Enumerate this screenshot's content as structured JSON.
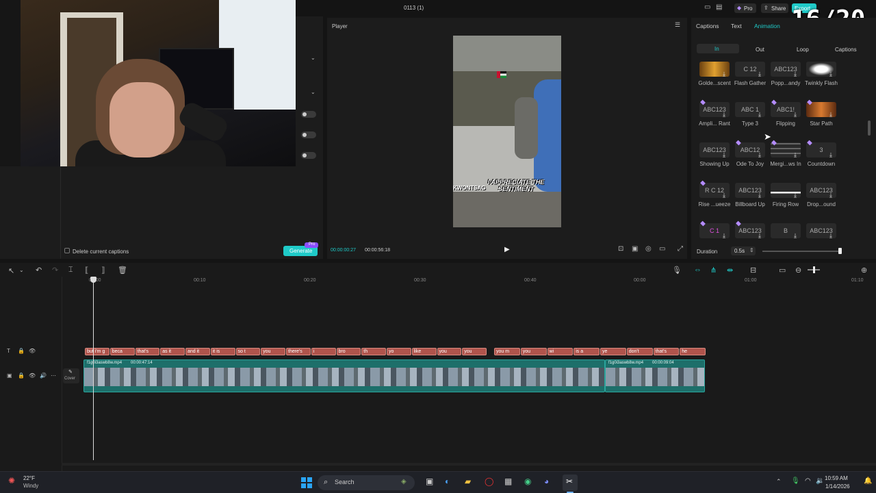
{
  "overlay": {
    "counter": "16/20"
  },
  "titlebar": {
    "title": "0113 (1)",
    "pro_label": "Pro",
    "share_label": "Share",
    "export_label": "Export"
  },
  "left": {
    "delete_captions_label": "Delete current captions",
    "generate_label": "Generate",
    "pro_badge": "Pro"
  },
  "player": {
    "title": "Player",
    "caption_text": "I APPRECIATE THE SENTIMENT",
    "side_text": "KWONTSAG",
    "current_time": "00:00:00:27",
    "total_time": "00:00:56:18"
  },
  "right": {
    "tabs": [
      "Captions",
      "Text",
      "Animation"
    ],
    "active_tab": "Animation",
    "subtabs": [
      "In",
      "Out",
      "Loop",
      "Captions"
    ],
    "active_subtab": "In",
    "presets": [
      {
        "label": "Golde...scent",
        "preview": ""
      },
      {
        "label": "Flash Gather",
        "preview": "C 12"
      },
      {
        "label": "Popp...andy",
        "preview": "ABC123"
      },
      {
        "label": "Twinkly Flash",
        "preview": ""
      },
      {
        "label": "Ampli... Rant",
        "preview": "ABC123"
      },
      {
        "label": "Type 3",
        "preview": "ABC 1"
      },
      {
        "label": "Flipping",
        "preview": "ABC1!"
      },
      {
        "label": "Star Path",
        "preview": ""
      },
      {
        "label": "Showing Up",
        "preview": "ABC123"
      },
      {
        "label": "Ode To Joy",
        "preview": "ABC12"
      },
      {
        "label": "Mergi...ws In",
        "preview": ""
      },
      {
        "label": "Countdown",
        "preview": "3"
      },
      {
        "label": "Rise ...ueeze",
        "preview": "R C 12"
      },
      {
        "label": "Billboard Up",
        "preview": "ABC123"
      },
      {
        "label": "Firing Row",
        "preview": ""
      },
      {
        "label": "Drop...ound",
        "preview": "ABC123"
      },
      {
        "label": "",
        "preview": "C 1"
      },
      {
        "label": "",
        "preview": "ABC123"
      },
      {
        "label": "",
        "preview": "B"
      },
      {
        "label": "",
        "preview": "ABC123"
      }
    ],
    "duration_label": "Duration",
    "duration_value": "0.5s"
  },
  "timeline": {
    "ticks": [
      "00:00",
      "00:10",
      "00:20",
      "00:30",
      "00:40",
      "00:00",
      "01:00",
      "01:10"
    ],
    "caption_clips": [
      "but i'm g",
      "beca",
      "that's",
      "as it",
      "and it",
      "it is",
      "so t",
      "you",
      "there's",
      "i",
      "bro",
      "th",
      "yo",
      "like",
      "you",
      "you",
      "you m",
      "you",
      "wi",
      "is a",
      "ye",
      "don't",
      "that's",
      "he"
    ],
    "video_clip_1": {
      "name": "f1g0i3aswb8w.mp4",
      "duration": "00:00:47:14"
    },
    "video_clip_2": {
      "name": "f1g0i3aswb8w.mp4",
      "duration": "00:00:09:04"
    },
    "cover_label": "Cover"
  },
  "taskbar": {
    "weather_temp": "22°F",
    "weather_desc": "Windy",
    "search_placeholder": "Search",
    "time": "10:59 AM",
    "date": "1/14/2026"
  },
  "colors": {
    "accent": "#1fcac8",
    "caption_clip": "#b0544c",
    "video_clip": "#1d6f6a",
    "pro_purple": "#8a4dff"
  }
}
